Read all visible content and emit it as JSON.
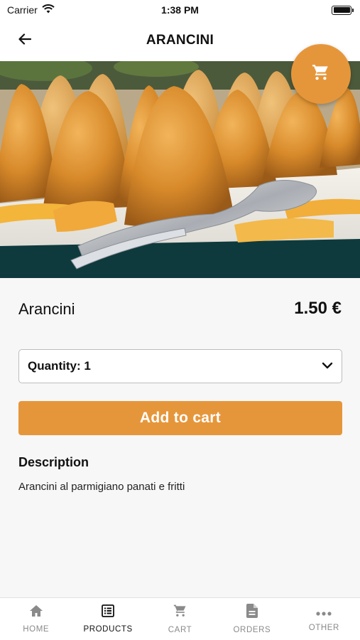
{
  "status_bar": {
    "carrier": "Carrier",
    "time": "1:38 PM"
  },
  "header": {
    "title": "ARANCINI"
  },
  "product": {
    "name": "Arancini",
    "price": "1.50 €",
    "quantity_label": "Quantity: 1",
    "add_to_cart_label": "Add to cart",
    "description_title": "Description",
    "description": "Arancini al parmigiano panati e fritti"
  },
  "colors": {
    "accent": "#e6963a",
    "background": "#f7f7f7"
  },
  "bottom_nav": {
    "items": [
      {
        "label": "HOME",
        "icon": "home-icon",
        "active": false
      },
      {
        "label": "PRODUCTS",
        "icon": "list-icon",
        "active": true
      },
      {
        "label": "CART",
        "icon": "cart-icon",
        "active": false
      },
      {
        "label": "ORDERS",
        "icon": "document-icon",
        "active": false
      },
      {
        "label": "OTHER",
        "icon": "more-icon",
        "active": false
      }
    ]
  }
}
